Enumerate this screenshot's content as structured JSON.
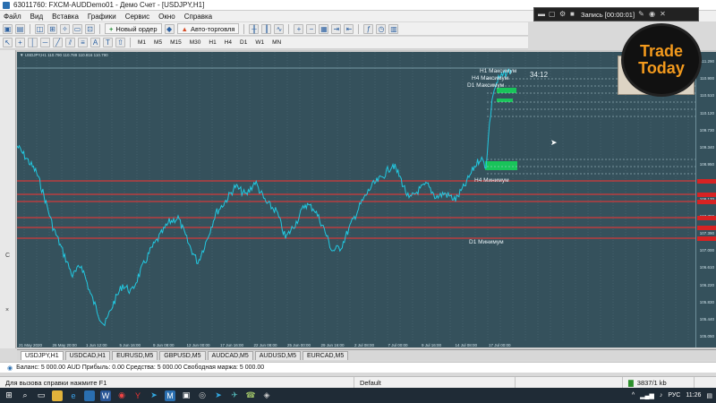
{
  "window": {
    "title": "63011760: FXCM-AUDDemo01 - Демо Счет - [USDJPY,H1]"
  },
  "menu": [
    "Файл",
    "Вид",
    "Вставка",
    "Графики",
    "Сервис",
    "Окно",
    "Справка"
  ],
  "toolbar": {
    "new_order": "Новый ордер",
    "auto_trading": "Авто-торговля",
    "timeframes": [
      "M1",
      "M5",
      "M15",
      "M30",
      "H1",
      "H4",
      "D1",
      "W1",
      "MN"
    ]
  },
  "recording": {
    "label": "Запись [00:00:01]"
  },
  "logo": {
    "line1": "Trade",
    "line2": "Today"
  },
  "chart": {
    "symbol_header": "▼ USDJPY,H1 110.790 110.789 110.816 110.790",
    "timer": "34:12",
    "annotations": {
      "h4_max": "H4 Максимум",
      "d1_max": "D1 Максимум",
      "h1_max": "H1 Максимум",
      "h4_min": "H4 Минимум",
      "d1_min": "D1 Минимум"
    },
    "x_labels": [
      "21 May 2020",
      "26 May 20:00",
      "1 Jun 12:00",
      "5 Jun 16:00",
      "9 Jun 08:00",
      "12 Jun 00:00",
      "17 Jun 16:00",
      "22 Jun 08:00",
      "25 Jun 00:00",
      "29 Jun 16:00",
      "2 Jul 08:00",
      "7 Jul 00:00",
      "9 Jul 16:00",
      "14 Jul 08:00",
      "17 Jul 00:00"
    ],
    "y_labels": [
      "111.290",
      "110.900",
      "110.510",
      "110.120",
      "109.730",
      "109.340",
      "108.950",
      "108.560",
      "108.170",
      "107.780",
      "107.390",
      "107.000",
      "106.610",
      "106.220",
      "105.830",
      "105.440",
      "105.050"
    ]
  },
  "tabs": [
    "USDJPY,H1",
    "USDCAD,H1",
    "EURUSD,M5",
    "GBPUSD,M5",
    "AUDCAD,M5",
    "AUDUSD,M5",
    "EURCAD,M5"
  ],
  "balance_line": "Баланс: 5 000.00 AUD  Прибыль: 0.00  Средства: 5 000.00  Свободная маржа: 5 000.00",
  "status": {
    "help": "Для вызова справки нажмите F1",
    "profile": "Default",
    "traffic": "3837/1 kb"
  },
  "taskbar": {
    "lang": "РУС",
    "time": "11:26"
  }
}
